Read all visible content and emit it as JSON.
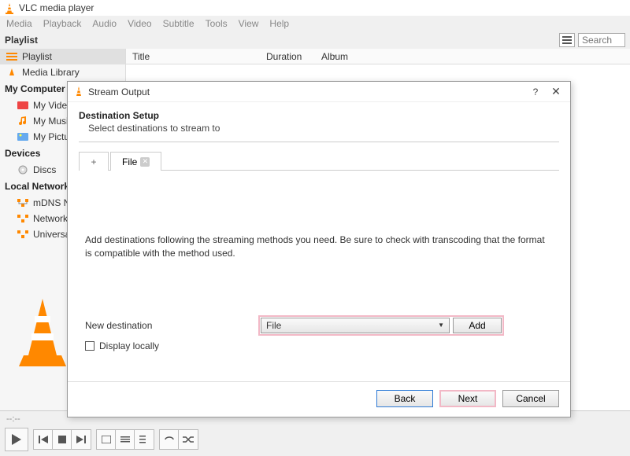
{
  "window": {
    "title": "VLC media player"
  },
  "menus": [
    "Media",
    "Playback",
    "Audio",
    "Video",
    "Subtitle",
    "Tools",
    "View",
    "Help"
  ],
  "playlist_header": {
    "label": "Playlist",
    "search_placeholder": "Search"
  },
  "columns": {
    "title": "Title",
    "duration": "Duration",
    "album": "Album"
  },
  "sidebar": {
    "sections": [
      {
        "label": "Playlist",
        "items": [
          {
            "label": "Playlist",
            "icon": "playlist-icon",
            "active": true
          },
          {
            "label": "Media Library",
            "icon": "library-icon"
          }
        ]
      },
      {
        "label": "My Computer",
        "items": [
          {
            "label": "My Videos",
            "icon": "videos-icon"
          },
          {
            "label": "My Music",
            "icon": "music-icon"
          },
          {
            "label": "My Pictures",
            "icon": "pictures-icon"
          }
        ]
      },
      {
        "label": "Devices",
        "items": [
          {
            "label": "Discs",
            "icon": "disc-icon"
          }
        ]
      },
      {
        "label": "Local Network",
        "items": [
          {
            "label": "mDNS Net",
            "icon": "network-icon"
          },
          {
            "label": "Network s",
            "icon": "network-icon"
          },
          {
            "label": "Universal l",
            "icon": "network-icon"
          }
        ]
      }
    ]
  },
  "player": {
    "time": "--:--"
  },
  "dialog": {
    "title": "Stream Output",
    "section_title": "Destination Setup",
    "section_sub": "Select destinations to stream to",
    "tabs": {
      "plus": "+",
      "file_label": "File"
    },
    "instructions": "Add destinations following the streaming methods you need. Be sure to check with transcoding that the format is compatible with the method used.",
    "new_dest_label": "New destination",
    "combo_value": "File",
    "add_btn": "Add",
    "display_locally": "Display locally",
    "buttons": {
      "back": "Back",
      "next": "Next",
      "cancel": "Cancel"
    }
  }
}
